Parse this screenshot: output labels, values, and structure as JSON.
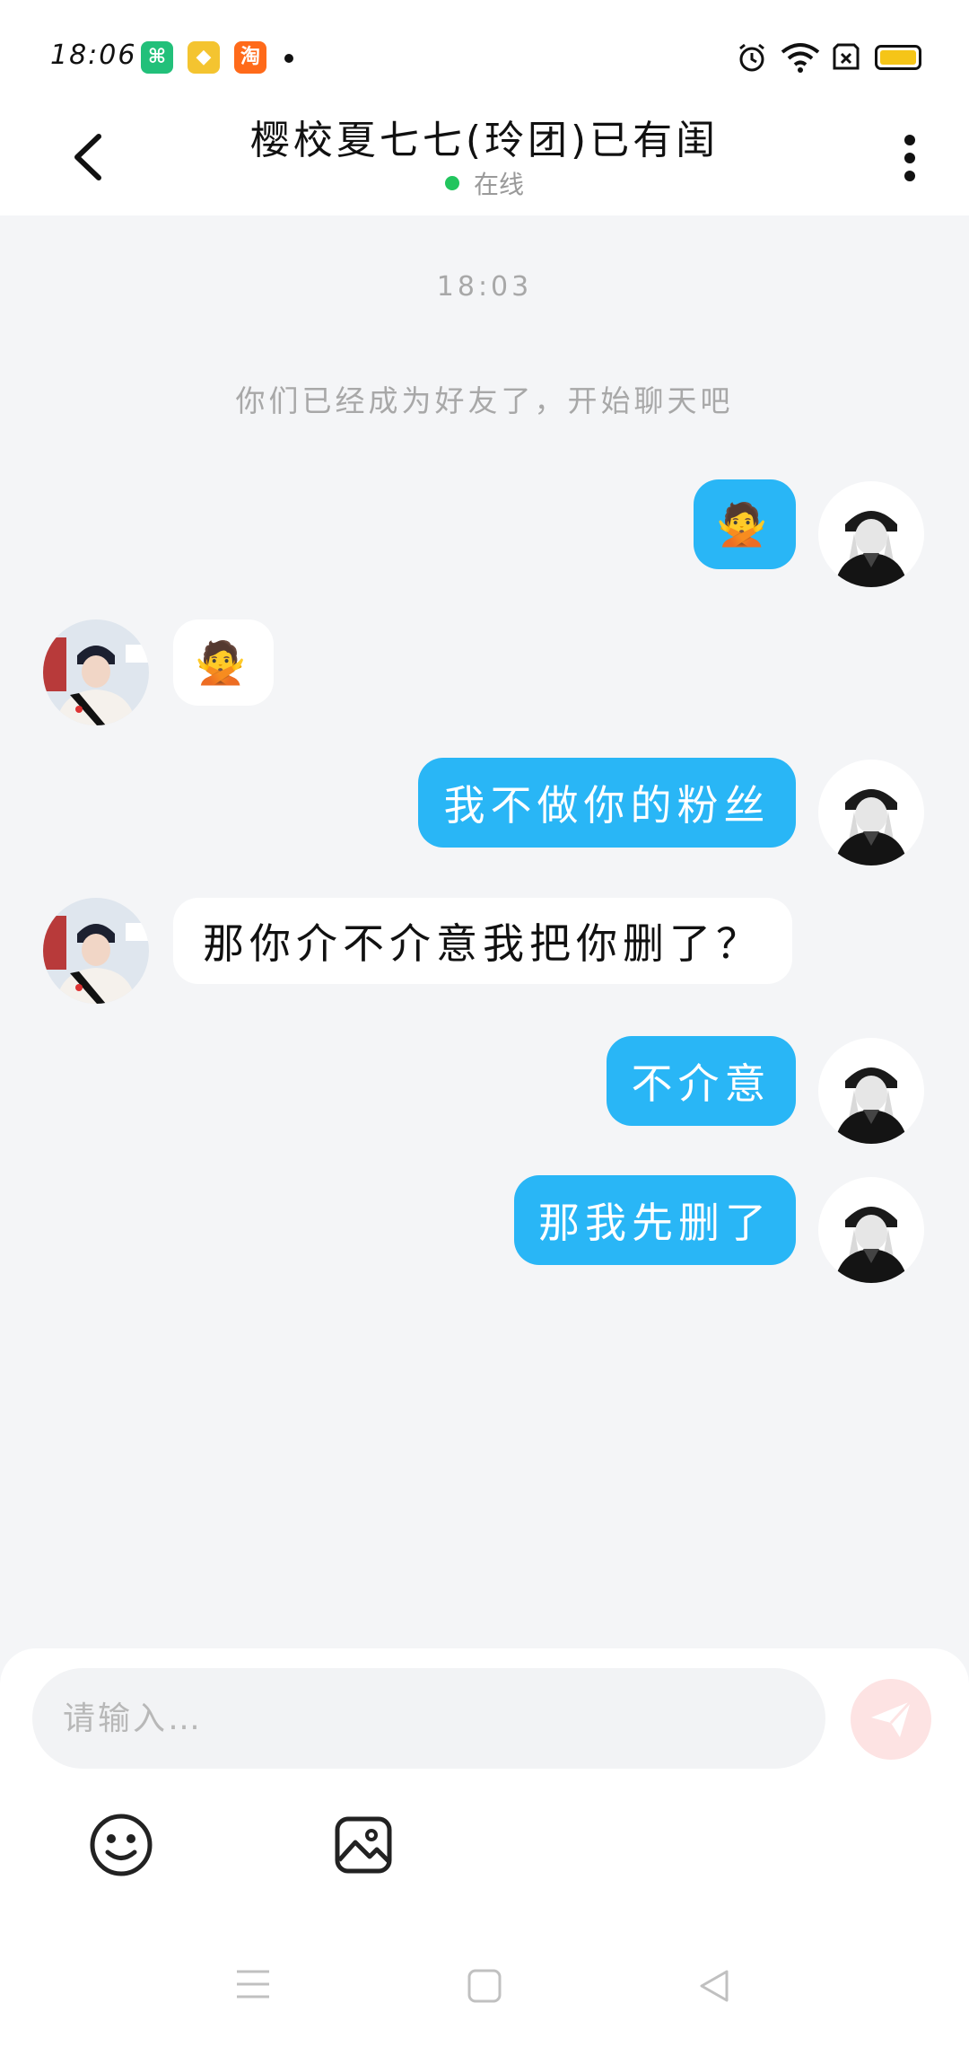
{
  "status_bar": {
    "time": "18:06",
    "app_icons": [
      {
        "icon": "wechat-icon",
        "glyph": "⌘",
        "color": "#22c07a"
      },
      {
        "icon": "diamond-app-icon",
        "glyph": "◆",
        "color": "#f4c430"
      },
      {
        "icon": "taobao-icon",
        "glyph": "淘",
        "color": "#ff6a1a"
      }
    ],
    "battery_color": "#f5c518"
  },
  "header": {
    "title": "樱校夏七七(玲团)已有闺",
    "presence": "在线",
    "presence_color": "#22c55e"
  },
  "chat": {
    "timestamp": "18:03",
    "system_message": "你们已经成为好友了，开始聊天吧",
    "messages": [
      {
        "side": "out",
        "text": "🙅"
      },
      {
        "side": "in",
        "text": "🙅"
      },
      {
        "side": "out",
        "text": "我不做你的粉丝"
      },
      {
        "side": "in",
        "text": "那你介不介意我把你删了？"
      },
      {
        "side": "out",
        "text": "不介意"
      },
      {
        "side": "out",
        "text": "那我先删了"
      }
    ]
  },
  "input": {
    "placeholder": "请输入…"
  },
  "colors": {
    "outgoing_bubble": "#29b6f6",
    "incoming_bubble": "#ffffff",
    "background": "#f4f5f7",
    "send_button": "#fde3e3"
  }
}
